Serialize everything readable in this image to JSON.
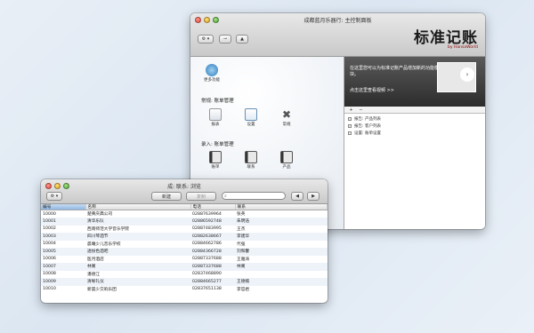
{
  "main_window": {
    "title": "成都蓝月乐器行: 主控制面板",
    "toolbar": {
      "gear_label": "⚙ ▾"
    },
    "brand": {
      "title": "标准记账",
      "subtitle": "by HansaWorld"
    },
    "more_functions": "更多功能",
    "section_general": "常规: 账单管理",
    "general_items": [
      {
        "label": "报表",
        "icon": "doc-icon"
      },
      {
        "label": "设置",
        "icon": "chart-icon"
      },
      {
        "label": "常规",
        "icon": "tools-icon"
      }
    ],
    "section_entry": "录入: 账单管理",
    "entry_items": [
      {
        "label": "账单",
        "icon": "book-icon"
      },
      {
        "label": "联系",
        "icon": "book-icon"
      },
      {
        "label": "产品",
        "icon": "book-icon"
      }
    ],
    "promo": {
      "text": "在这里您可以为标准记账产品增加新的功能模块。",
      "link": "点击这里查看视频 >>"
    },
    "right_toolbar": {
      "add": "+",
      "remove": "−"
    },
    "right_list": [
      "报告: 产品列表",
      "报告: 客户列表",
      "设置: 账单设置"
    ]
  },
  "list_window": {
    "title": "成: 联系: 浏览",
    "toolbar": {
      "gear_label": "⚙ ▾",
      "new_label": "新建",
      "copy_label": "复制"
    },
    "search": {
      "placeholder": ""
    },
    "columns": [
      "编号",
      "名称",
      "电话",
      "联系"
    ],
    "rows": [
      [
        "10000",
        "楚黄庆典公司",
        "02887639964",
        "张英"
      ],
      [
        "10001",
        "清华乐队",
        "02886592748",
        "朱明浩"
      ],
      [
        "10002",
        "西南师范大学音乐学院",
        "02887483995",
        "王杰"
      ],
      [
        "10003",
        "四川琴酒节",
        "02882638667",
        "李建华"
      ],
      [
        "10004",
        "晨曦少儿音乐学校",
        "02884662786",
        "代强"
      ],
      [
        "10005",
        "透纷色酒吧",
        "02884366728",
        "刘和馨"
      ],
      [
        "10006",
        "医月酒店",
        "02887337688",
        "王雅涛"
      ],
      [
        "10007",
        "林阁",
        "02887337688",
        "林阁"
      ],
      [
        "10008",
        "潘德江",
        "02837468890",
        ""
      ],
      [
        "10009",
        "清晰礼仪",
        "02884665277",
        "王德楠"
      ],
      [
        "10010",
        "新晨少交响乐团",
        "02837651138",
        "李官君"
      ]
    ]
  }
}
